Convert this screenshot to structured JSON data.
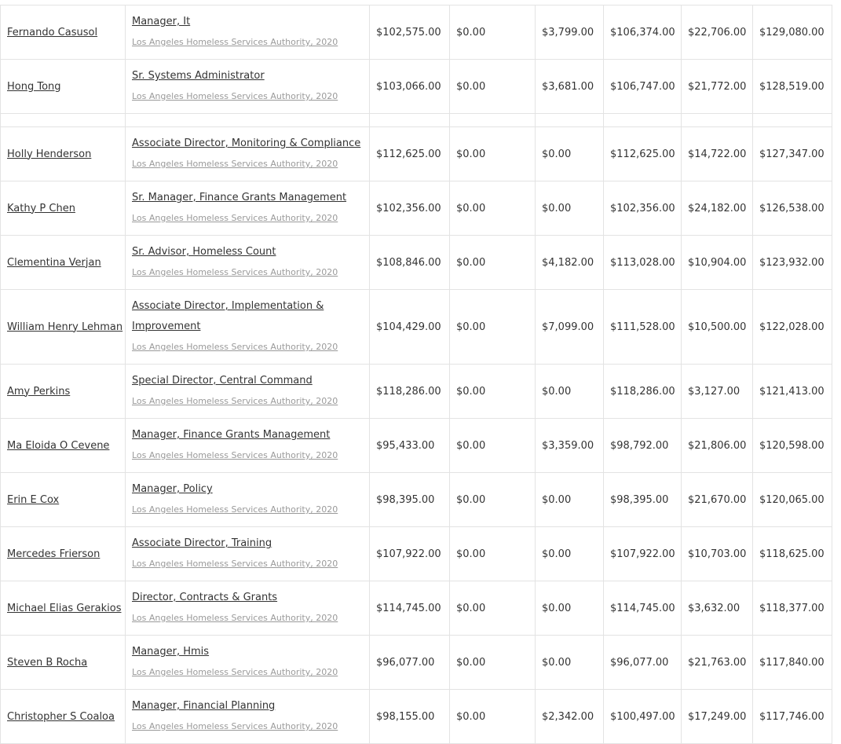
{
  "rows_top": [
    {
      "name": "Fernando Casusol",
      "title": "Manager, It",
      "agency": "Los Angeles Homeless Services Authority, 2020",
      "regular": "$102,575.00",
      "overtime": "$0.00",
      "other": "$3,799.00",
      "total": "$106,374.00",
      "benefits": "$22,706.00",
      "total_benefits": "$129,080.00"
    },
    {
      "name": "Hong Tong",
      "title": "Sr. Systems Administrator",
      "agency": "Los Angeles Homeless Services Authority, 2020",
      "regular": "$103,066.00",
      "overtime": "$0.00",
      "other": "$3,681.00",
      "total": "$106,747.00",
      "benefits": "$21,772.00",
      "total_benefits": "$128,519.00"
    }
  ],
  "rows_bottom": [
    {
      "name": "Holly Henderson",
      "title": "Associate Director, Monitoring & Compliance",
      "agency": "Los Angeles Homeless Services Authority, 2020",
      "regular": "$112,625.00",
      "overtime": "$0.00",
      "other": "$0.00",
      "total": "$112,625.00",
      "benefits": "$14,722.00",
      "total_benefits": "$127,347.00"
    },
    {
      "name": "Kathy P Chen",
      "title": "Sr. Manager, Finance Grants Management",
      "agency": "Los Angeles Homeless Services Authority, 2020",
      "regular": "$102,356.00",
      "overtime": "$0.00",
      "other": "$0.00",
      "total": "$102,356.00",
      "benefits": "$24,182.00",
      "total_benefits": "$126,538.00"
    },
    {
      "name": "Clementina Verjan",
      "title": "Sr. Advisor, Homeless Count",
      "agency": "Los Angeles Homeless Services Authority, 2020",
      "regular": "$108,846.00",
      "overtime": "$0.00",
      "other": "$4,182.00",
      "total": "$113,028.00",
      "benefits": "$10,904.00",
      "total_benefits": "$123,932.00"
    },
    {
      "name": "William Henry Lehman",
      "title": "Associate Director, Implementation & Improvement",
      "agency": "Los Angeles Homeless Services Authority, 2020",
      "regular": "$104,429.00",
      "overtime": "$0.00",
      "other": "$7,099.00",
      "total": "$111,528.00",
      "benefits": "$10,500.00",
      "total_benefits": "$122,028.00",
      "tall": true
    },
    {
      "name": "Amy Perkins",
      "title": "Special Director, Central Command",
      "agency": "Los Angeles Homeless Services Authority, 2020",
      "regular": "$118,286.00",
      "overtime": "$0.00",
      "other": "$0.00",
      "total": "$118,286.00",
      "benefits": "$3,127.00",
      "total_benefits": "$121,413.00"
    },
    {
      "name": "Ma Eloida O Cevene",
      "title": "Manager, Finance Grants Management",
      "agency": "Los Angeles Homeless Services Authority, 2020",
      "regular": "$95,433.00",
      "overtime": "$0.00",
      "other": "$3,359.00",
      "total": "$98,792.00",
      "benefits": "$21,806.00",
      "total_benefits": "$120,598.00"
    },
    {
      "name": "Erin E Cox",
      "title": "Manager, Policy",
      "agency": "Los Angeles Homeless Services Authority, 2020",
      "regular": "$98,395.00",
      "overtime": "$0.00",
      "other": "$0.00",
      "total": "$98,395.00",
      "benefits": "$21,670.00",
      "total_benefits": "$120,065.00"
    },
    {
      "name": "Mercedes Frierson",
      "title": "Associate Director, Training",
      "agency": "Los Angeles Homeless Services Authority, 2020",
      "regular": "$107,922.00",
      "overtime": "$0.00",
      "other": "$0.00",
      "total": "$107,922.00",
      "benefits": "$10,703.00",
      "total_benefits": "$118,625.00"
    },
    {
      "name": "Michael Elias Gerakios",
      "title": "Director, Contracts & Grants",
      "agency": "Los Angeles Homeless Services Authority, 2020",
      "regular": "$114,745.00",
      "overtime": "$0.00",
      "other": "$0.00",
      "total": "$114,745.00",
      "benefits": "$3,632.00",
      "total_benefits": "$118,377.00"
    },
    {
      "name": "Steven B Rocha",
      "title": "Manager, Hmis",
      "agency": "Los Angeles Homeless Services Authority, 2020",
      "regular": "$96,077.00",
      "overtime": "$0.00",
      "other": "$0.00",
      "total": "$96,077.00",
      "benefits": "$21,763.00",
      "total_benefits": "$117,840.00"
    },
    {
      "name": "Christopher S Coaloa",
      "title": "Manager, Financial Planning",
      "agency": "Los Angeles Homeless Services Authority, 2020",
      "regular": "$98,155.00",
      "overtime": "$0.00",
      "other": "$2,342.00",
      "total": "$100,497.00",
      "benefits": "$17,249.00",
      "total_benefits": "$117,746.00"
    }
  ]
}
